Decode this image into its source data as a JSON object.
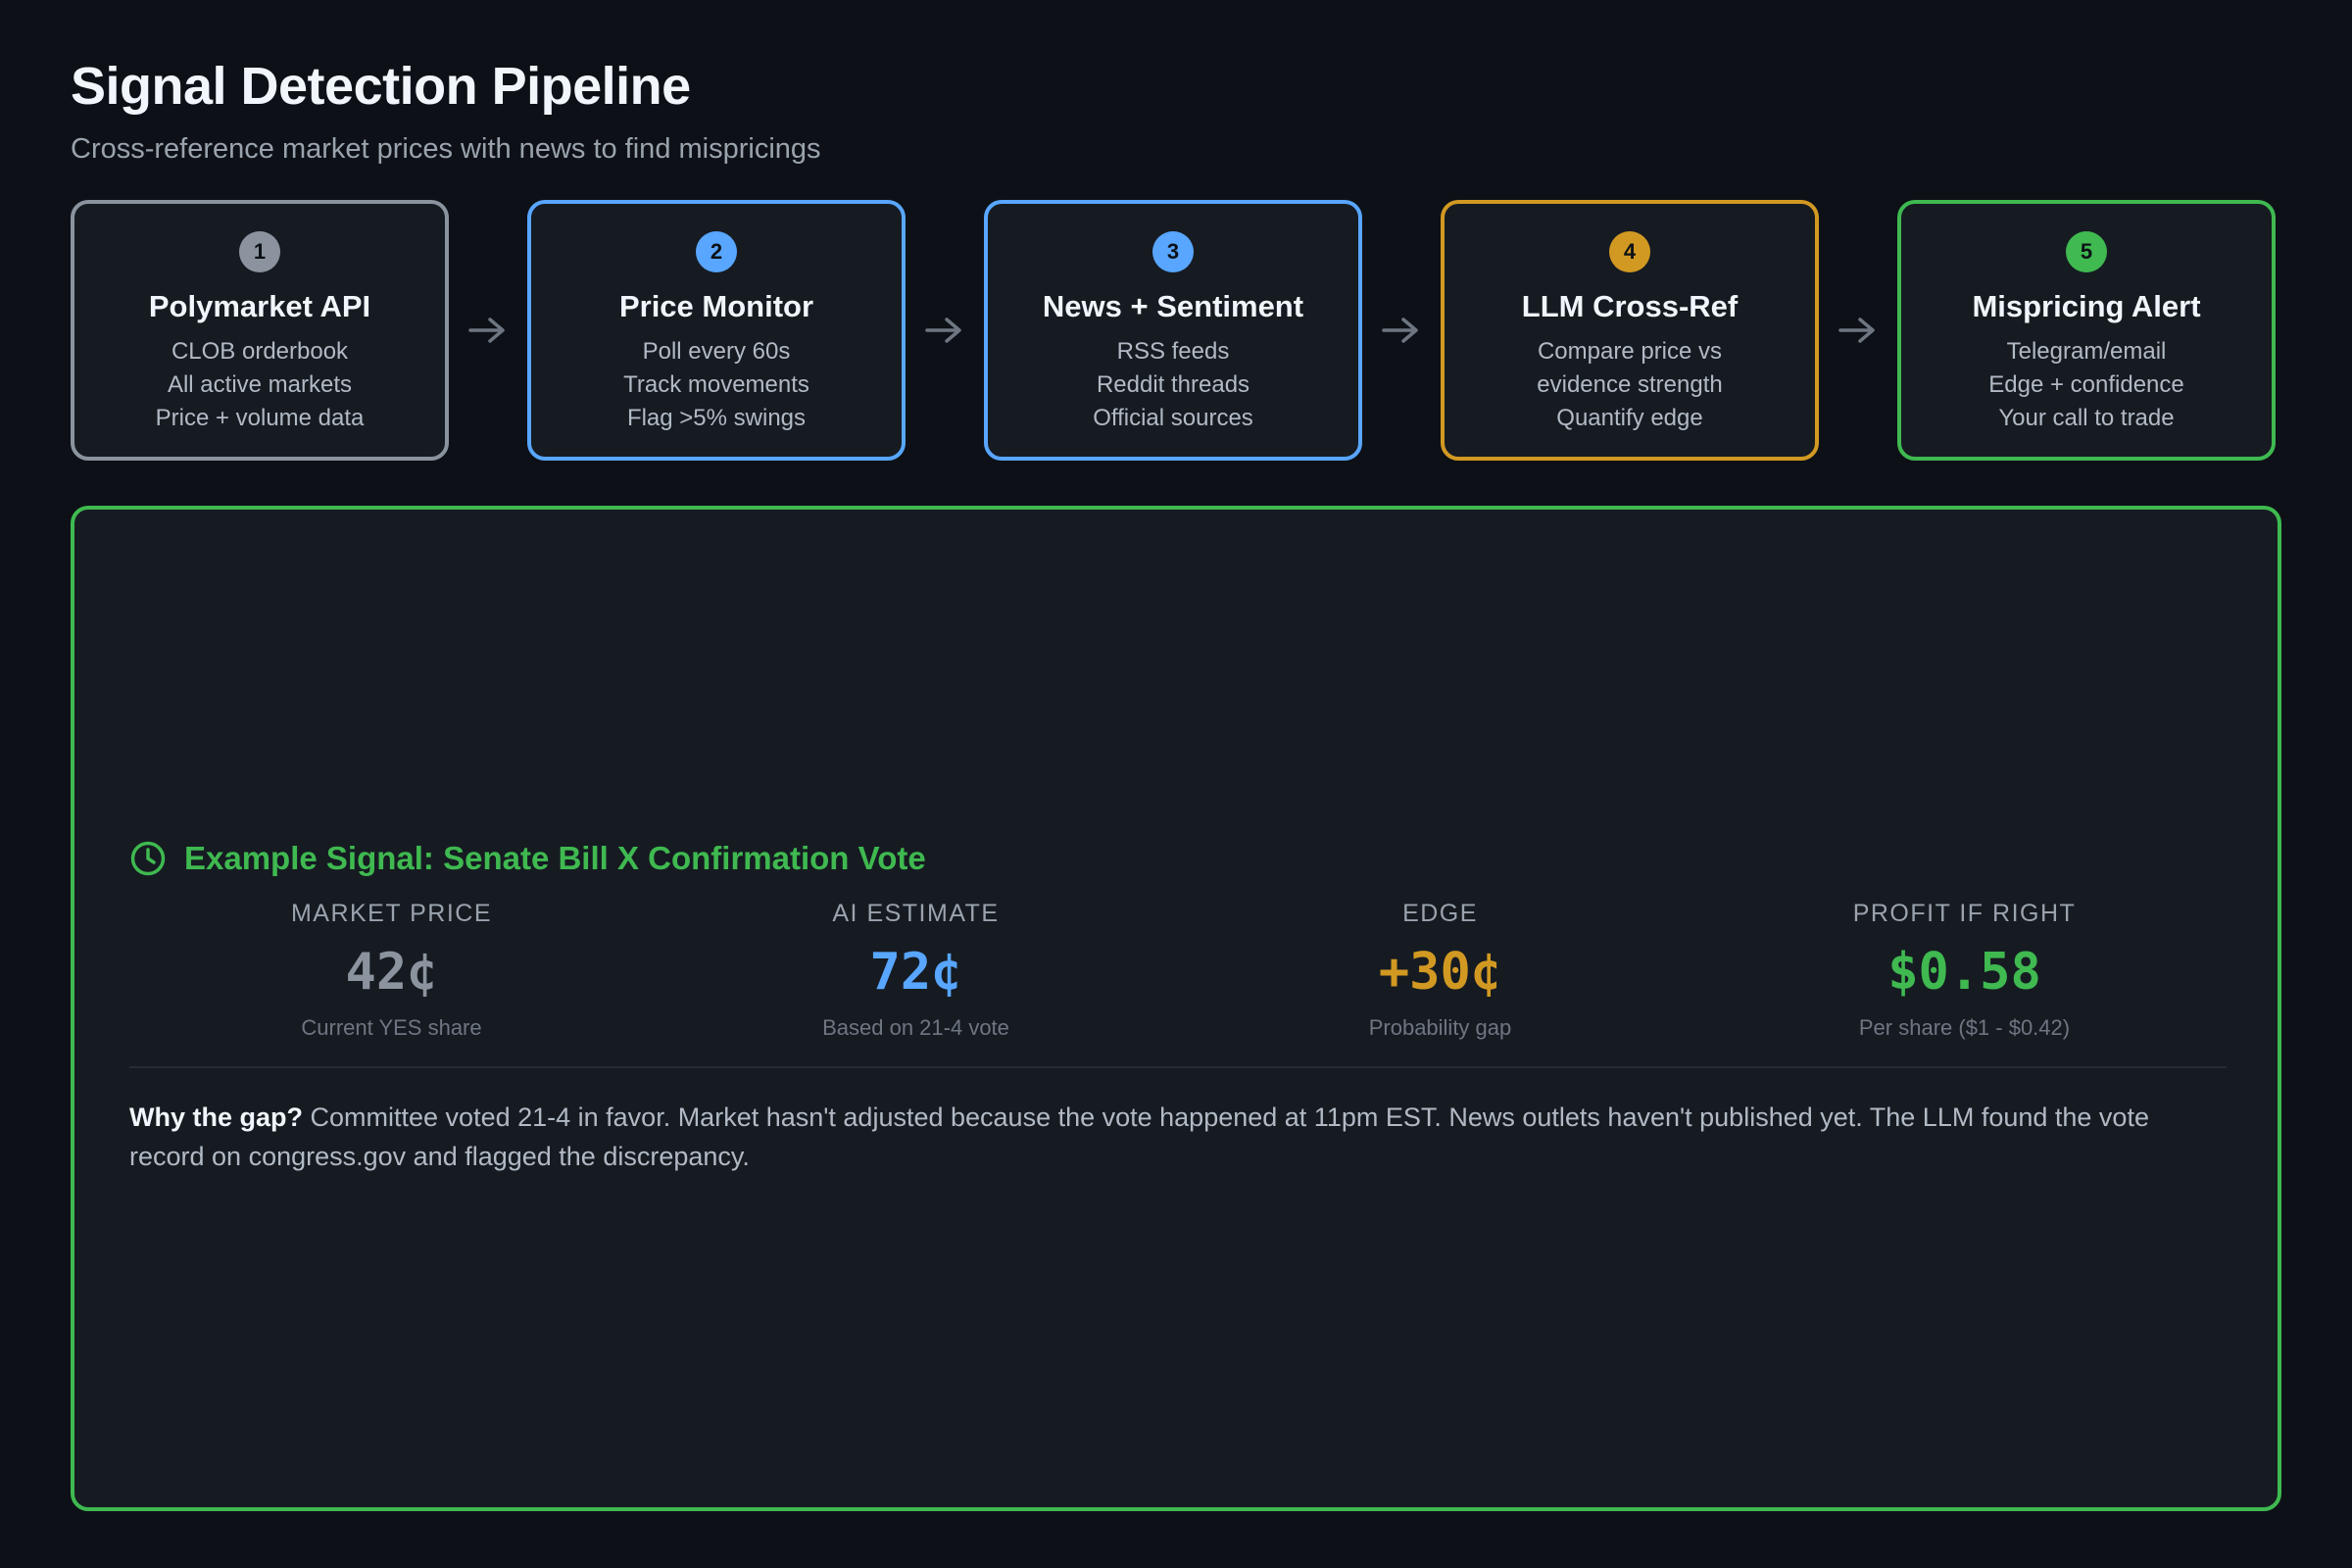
{
  "header": {
    "title": "Signal Detection Pipeline",
    "subtitle": "Cross-reference market prices with news to find mispricings"
  },
  "pipeline": {
    "steps": [
      {
        "number": "1",
        "title": "Polymarket API",
        "lines": [
          "CLOB orderbook",
          "All active markets",
          "Price + volume data"
        ],
        "color": "#8b949e"
      },
      {
        "number": "2",
        "title": "Price Monitor",
        "lines": [
          "Poll every 60s",
          "Track movements",
          "Flag >5% swings"
        ],
        "color": "#58a6ff"
      },
      {
        "number": "3",
        "title": "News + Sentiment",
        "lines": [
          "RSS feeds",
          "Reddit threads",
          "Official sources"
        ],
        "color": "#58a6ff"
      },
      {
        "number": "4",
        "title": "LLM Cross-Ref",
        "lines": [
          "Compare price vs",
          "evidence strength",
          "Quantify edge"
        ],
        "color": "#d29922"
      },
      {
        "number": "5",
        "title": "Mispricing Alert",
        "lines": [
          "Telegram/email",
          "Edge + confidence",
          "Your call to trade"
        ],
        "color": "#3fb950"
      }
    ],
    "arrow_icon": "arrow-right-icon"
  },
  "signal": {
    "icon": "clock-icon",
    "title": "Example Signal: Senate Bill X Confirmation Vote",
    "accent": "#3fb950",
    "metrics": [
      {
        "label": "MARKET PRICE",
        "value": "42¢",
        "sub": "Current YES share",
        "color": "#8b949e"
      },
      {
        "label": "AI ESTIMATE",
        "value": "72¢",
        "sub": "Based on 21-4 vote",
        "color": "#58a6ff"
      },
      {
        "label": "EDGE",
        "value": "+30¢",
        "sub": "Probability gap",
        "color": "#d29922"
      },
      {
        "label": "PROFIT IF RIGHT",
        "value": "$0.58",
        "sub": "Per share ($1 - $0.42)",
        "color": "#3fb950"
      }
    ],
    "why_label": "Why the gap?",
    "why_text": "Committee voted 21-4 in favor. Market hasn't adjusted because the vote happened at 11pm EST. News outlets haven't published yet. The LLM found the vote record on congress.gov and flagged the discrepancy."
  }
}
